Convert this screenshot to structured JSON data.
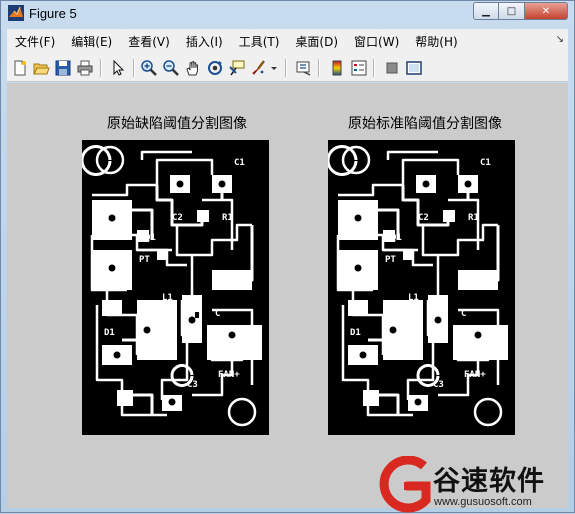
{
  "window": {
    "title": "Figure 5",
    "min_symbol": "▁",
    "max_symbol": "□",
    "close_symbol": "✕"
  },
  "menu": {
    "items": [
      "文件(F)",
      "编辑(E)",
      "查看(V)",
      "插入(I)",
      "工具(T)",
      "桌面(D)",
      "窗口(W)",
      "帮助(H)"
    ],
    "dock_symbol": "↘"
  },
  "toolbar": {
    "icons": [
      "new-figure-icon",
      "open-file-icon",
      "save-icon",
      "print-icon",
      "arrow-select-icon",
      "zoom-in-icon",
      "zoom-out-icon",
      "pan-hand-icon",
      "rotate-3d-icon",
      "data-cursor-icon",
      "brush-icon",
      "brush-dropdown-icon",
      "link-plot-icon",
      "colorbar-icon",
      "legend-icon",
      "hide-plot-tools-icon",
      "show-plot-tools-icon"
    ]
  },
  "figure": {
    "left_title": "原始缺陷阈值分割图像",
    "right_title": "原始标准陷阈值分割图像",
    "pcb_labels": {
      "c1": "C1",
      "c2": "C2",
      "q1": "Q1",
      "pt": "PT",
      "r1": "R1",
      "u1": "U1",
      "l1": "L1",
      "d1": "D1",
      "c3": "C3",
      "fan": "FAN+",
      "c": "C"
    }
  },
  "watermark": {
    "name": "谷速软件",
    "url": "www.gusuosoft.com"
  },
  "colors": {
    "figure_bg": "#cbcbcb",
    "menubar_bg": "#f0f0f0",
    "pcb_background": "#000000",
    "pcb_trace": "#ffffff",
    "watermark_red": "#d9281f"
  }
}
